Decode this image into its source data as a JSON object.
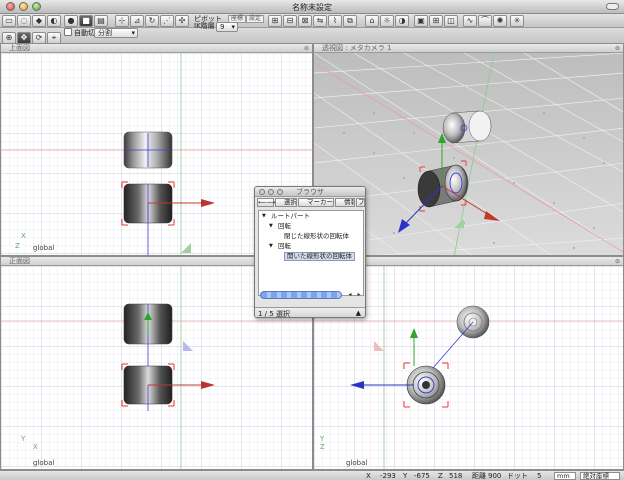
{
  "window": {
    "title": "名称未設定"
  },
  "toolbar": {
    "pivot_label": "ピボット",
    "pivot_state": "IK階層",
    "pivot_value": "9",
    "coord_label": "座標",
    "settings_label": "設定",
    "auto_switch_label": "自動切替",
    "split_select": "分割"
  },
  "viewports": {
    "top": {
      "title": "上面図",
      "global": "global",
      "axis_x": "X",
      "axis_y": "Z"
    },
    "perspective": {
      "title": "透視図 : メタカメラ 1"
    },
    "front": {
      "title": "正面図",
      "global": "global",
      "axis_x": "X",
      "axis_y": "Y"
    },
    "side": {
      "global": "global",
      "axis_x": "Z",
      "axis_y": "Y"
    }
  },
  "browser": {
    "title": "ブラウザ",
    "menus": [
      "選択",
      "マーカー",
      "情報",
      "ブ"
    ],
    "tree": [
      {
        "label": "ルートパート",
        "level": 0,
        "expanded": true
      },
      {
        "label": "回転",
        "level": 1,
        "expanded": true
      },
      {
        "label": "閉じた線形状の回転体",
        "level": 2,
        "expanded": false
      },
      {
        "label": "回転",
        "level": 1,
        "expanded": true
      },
      {
        "label": "開いた線形状の回転体",
        "level": 2,
        "expanded": false,
        "selected": true
      }
    ],
    "status": "1 / 5 選択"
  },
  "statusbar": {
    "x_label": "X",
    "x_value": "-293",
    "y_label": "Y",
    "y_value": "-675",
    "z_label": "Z",
    "z_value": "518",
    "dist_label": "距離",
    "dist_value": "900",
    "dot_label": "ドット",
    "dot_value": "5",
    "unit": "mm",
    "coord_mode": "絶対座標"
  },
  "colors": {
    "axis_x": "#d43b3b",
    "axis_y": "#2fa52f",
    "axis_z": "#2b33c8",
    "grid_line": "#c8c8e0",
    "guide_red": "#e8a0a0",
    "guide_green": "#90c890"
  }
}
